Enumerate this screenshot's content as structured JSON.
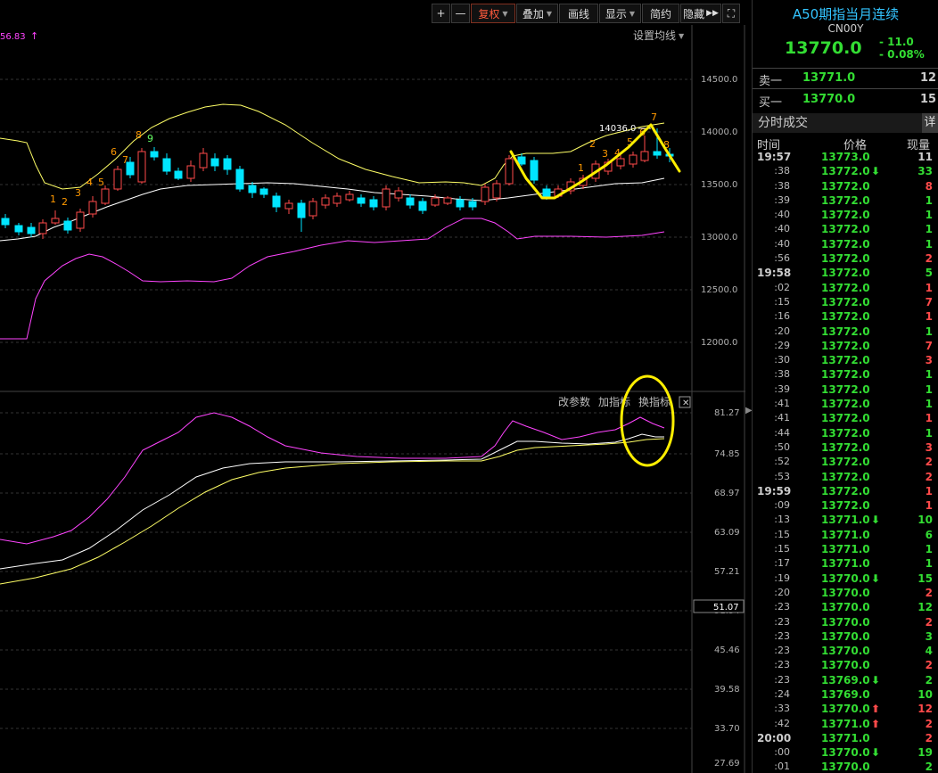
{
  "toolbar": {
    "plus": "+",
    "minus": "—",
    "restore_rights": "复权",
    "overlay": "叠加",
    "draw_line": "画线",
    "display": "显示",
    "simple": "简约",
    "hide": "隐藏",
    "fullscreen_icon": "fullscreen-icon"
  },
  "chart": {
    "top_left_value": "56.83",
    "set_ma": "设置均线",
    "price_axis": [
      "14500.0",
      "14000.0",
      "13500.0",
      "13000.0",
      "12500.0",
      "12000.0"
    ],
    "candle_tag": "14036.0",
    "td_left": [
      "1",
      "2",
      "3",
      "4",
      "5",
      "6",
      "7",
      "8",
      "9"
    ],
    "td_right": [
      "1",
      "2",
      "3",
      "4",
      "5",
      "6",
      "7",
      "8"
    ],
    "indicator_buttons": {
      "modify": "改参数",
      "add": "加指标",
      "switch": "换指标"
    },
    "indicator_axis": [
      "81.27",
      "74.85",
      "68.97",
      "63.09",
      "57.21",
      "51.34",
      "45.46",
      "39.58",
      "33.70",
      "27.69"
    ],
    "current_indicator_value": "51.07",
    "colors": {
      "up": "#ff4a4a",
      "down": "#00e5ff",
      "boll_outer_upper": "#ffff66",
      "boll_mid": "#ffffff",
      "boll_lower": "#ff44ff",
      "annotation": "#ffee00"
    }
  },
  "panel": {
    "title": "A50期指当月连续",
    "code": "CN00Y",
    "price": "13770.0",
    "change": "- 11.0",
    "change_pct": "- 0.08%",
    "sell_label": "卖一",
    "sell_price": "13771.0",
    "sell_vol": "12",
    "buy_label": "买一",
    "buy_price": "13770.0",
    "buy_vol": "15",
    "ticks_title": "分时成交",
    "detail": "详",
    "col_time": "时间",
    "col_price": "价格",
    "col_vol": "现量"
  },
  "trades": [
    {
      "time": "19:57",
      "major": true,
      "price": "13773.0",
      "arrow": "",
      "vol": "11",
      "vol_color": "#ccc"
    },
    {
      "time": ":38",
      "major": false,
      "price": "13772.0",
      "arrow": "down",
      "vol": "33",
      "vol_color": "#33dd33"
    },
    {
      "time": ":38",
      "major": false,
      "price": "13772.0",
      "arrow": "",
      "vol": "8",
      "vol_color": "#ff4a4a"
    },
    {
      "time": ":39",
      "major": false,
      "price": "13772.0",
      "arrow": "",
      "vol": "1",
      "vol_color": "#33dd33"
    },
    {
      "time": ":40",
      "major": false,
      "price": "13772.0",
      "arrow": "",
      "vol": "1",
      "vol_color": "#33dd33"
    },
    {
      "time": ":40",
      "major": false,
      "price": "13772.0",
      "arrow": "",
      "vol": "1",
      "vol_color": "#33dd33"
    },
    {
      "time": ":40",
      "major": false,
      "price": "13772.0",
      "arrow": "",
      "vol": "1",
      "vol_color": "#33dd33"
    },
    {
      "time": ":56",
      "major": false,
      "price": "13772.0",
      "arrow": "",
      "vol": "2",
      "vol_color": "#ff4a4a"
    },
    {
      "time": "19:58",
      "major": true,
      "price": "13772.0",
      "arrow": "",
      "vol": "5",
      "vol_color": "#33dd33"
    },
    {
      "time": ":02",
      "major": false,
      "price": "13772.0",
      "arrow": "",
      "vol": "1",
      "vol_color": "#ff4a4a"
    },
    {
      "time": ":15",
      "major": false,
      "price": "13772.0",
      "arrow": "",
      "vol": "7",
      "vol_color": "#ff4a4a"
    },
    {
      "time": ":16",
      "major": false,
      "price": "13772.0",
      "arrow": "",
      "vol": "1",
      "vol_color": "#ff4a4a"
    },
    {
      "time": ":20",
      "major": false,
      "price": "13772.0",
      "arrow": "",
      "vol": "1",
      "vol_color": "#33dd33"
    },
    {
      "time": ":29",
      "major": false,
      "price": "13772.0",
      "arrow": "",
      "vol": "7",
      "vol_color": "#ff4a4a"
    },
    {
      "time": ":30",
      "major": false,
      "price": "13772.0",
      "arrow": "",
      "vol": "3",
      "vol_color": "#ff4a4a"
    },
    {
      "time": ":38",
      "major": false,
      "price": "13772.0",
      "arrow": "",
      "vol": "1",
      "vol_color": "#33dd33"
    },
    {
      "time": ":39",
      "major": false,
      "price": "13772.0",
      "arrow": "",
      "vol": "1",
      "vol_color": "#33dd33"
    },
    {
      "time": ":41",
      "major": false,
      "price": "13772.0",
      "arrow": "",
      "vol": "1",
      "vol_color": "#33dd33"
    },
    {
      "time": ":41",
      "major": false,
      "price": "13772.0",
      "arrow": "",
      "vol": "1",
      "vol_color": "#ff4a4a"
    },
    {
      "time": ":44",
      "major": false,
      "price": "13772.0",
      "arrow": "",
      "vol": "1",
      "vol_color": "#33dd33"
    },
    {
      "time": ":50",
      "major": false,
      "price": "13772.0",
      "arrow": "",
      "vol": "3",
      "vol_color": "#ff4a4a"
    },
    {
      "time": ":52",
      "major": false,
      "price": "13772.0",
      "arrow": "",
      "vol": "2",
      "vol_color": "#ff4a4a"
    },
    {
      "time": ":53",
      "major": false,
      "price": "13772.0",
      "arrow": "",
      "vol": "2",
      "vol_color": "#ff4a4a"
    },
    {
      "time": "19:59",
      "major": true,
      "price": "13772.0",
      "arrow": "",
      "vol": "1",
      "vol_color": "#ff4a4a"
    },
    {
      "time": ":09",
      "major": false,
      "price": "13772.0",
      "arrow": "",
      "vol": "1",
      "vol_color": "#ff4a4a"
    },
    {
      "time": ":13",
      "major": false,
      "price": "13771.0",
      "arrow": "down",
      "vol": "10",
      "vol_color": "#33dd33"
    },
    {
      "time": ":15",
      "major": false,
      "price": "13771.0",
      "arrow": "",
      "vol": "6",
      "vol_color": "#33dd33"
    },
    {
      "time": ":15",
      "major": false,
      "price": "13771.0",
      "arrow": "",
      "vol": "1",
      "vol_color": "#33dd33"
    },
    {
      "time": ":17",
      "major": false,
      "price": "13771.0",
      "arrow": "",
      "vol": "1",
      "vol_color": "#33dd33"
    },
    {
      "time": ":19",
      "major": false,
      "price": "13770.0",
      "arrow": "down",
      "vol": "15",
      "vol_color": "#33dd33"
    },
    {
      "time": ":20",
      "major": false,
      "price": "13770.0",
      "arrow": "",
      "vol": "2",
      "vol_color": "#ff4a4a"
    },
    {
      "time": ":23",
      "major": false,
      "price": "13770.0",
      "arrow": "",
      "vol": "12",
      "vol_color": "#33dd33"
    },
    {
      "time": ":23",
      "major": false,
      "price": "13770.0",
      "arrow": "",
      "vol": "2",
      "vol_color": "#ff4a4a"
    },
    {
      "time": ":23",
      "major": false,
      "price": "13770.0",
      "arrow": "",
      "vol": "3",
      "vol_color": "#33dd33"
    },
    {
      "time": ":23",
      "major": false,
      "price": "13770.0",
      "arrow": "",
      "vol": "4",
      "vol_color": "#33dd33"
    },
    {
      "time": ":23",
      "major": false,
      "price": "13770.0",
      "arrow": "",
      "vol": "2",
      "vol_color": "#ff4a4a"
    },
    {
      "time": ":23",
      "major": false,
      "price": "13769.0",
      "arrow": "down",
      "vol": "2",
      "vol_color": "#33dd33"
    },
    {
      "time": ":24",
      "major": false,
      "price": "13769.0",
      "arrow": "",
      "vol": "10",
      "vol_color": "#33dd33"
    },
    {
      "time": ":33",
      "major": false,
      "price": "13770.0",
      "arrow": "up",
      "vol": "12",
      "vol_color": "#ff4a4a"
    },
    {
      "time": ":42",
      "major": false,
      "price": "13771.0",
      "arrow": "up",
      "vol": "2",
      "vol_color": "#ff4a4a"
    },
    {
      "time": "20:00",
      "major": true,
      "price": "13771.0",
      "arrow": "",
      "vol": "2",
      "vol_color": "#ff4a4a"
    },
    {
      "time": ":00",
      "major": false,
      "price": "13770.0",
      "arrow": "down",
      "vol": "19",
      "vol_color": "#33dd33"
    },
    {
      "time": ":01",
      "major": false,
      "price": "13770.0",
      "arrow": "",
      "vol": "2",
      "vol_color": "#33dd33"
    }
  ]
}
